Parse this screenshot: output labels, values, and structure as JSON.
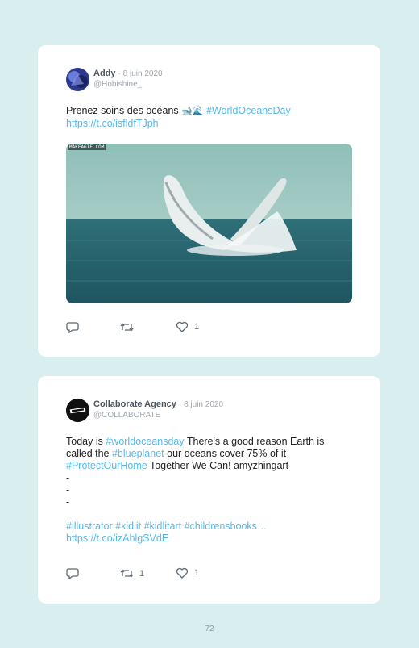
{
  "tweets": [
    {
      "author": "Addy",
      "date": "· 8 juin 2020",
      "handle": "@Hobishine_",
      "text_plain": "Prenez soins des océans ",
      "emoji": "🐋🌊",
      "hashtag": "#WorldOceansDay",
      "link": "https://t.co/isfldfTJph",
      "media_watermark": "MAKEAGIF.COM",
      "replies": "",
      "retweets": "",
      "likes": "1"
    },
    {
      "author": "Collaborate Agency",
      "date": "· 8 juin 2020",
      "handle": "@COLLABORATE",
      "line1_a": "Today is ",
      "line1_tag": "#worldoceansday",
      "line1_b": " There's a good reason Earth is",
      "line2_a": "called the ",
      "line2_tag": "#blueplanet",
      "line2_b": " our oceans cover 75% of it",
      "line3_tag": "#ProtectOurHome",
      "line3_b": " Together We Can! amyzhingart",
      "dash1": "-",
      "dash2": "-",
      "dash3": "-",
      "tags_line": "#illustrator #kidlit #kidlitart #childrensbooks…",
      "link": "https://t.co/izAhlgSVdE",
      "replies": "",
      "retweets": "1",
      "likes": "1"
    }
  ],
  "page_number": "72",
  "colors": {
    "background": "#d9eeee",
    "card": "#ffffff",
    "link": "#5bb8e6"
  },
  "icons": {
    "reply": "reply-icon",
    "retweet": "retweet-icon",
    "like": "heart-icon"
  }
}
